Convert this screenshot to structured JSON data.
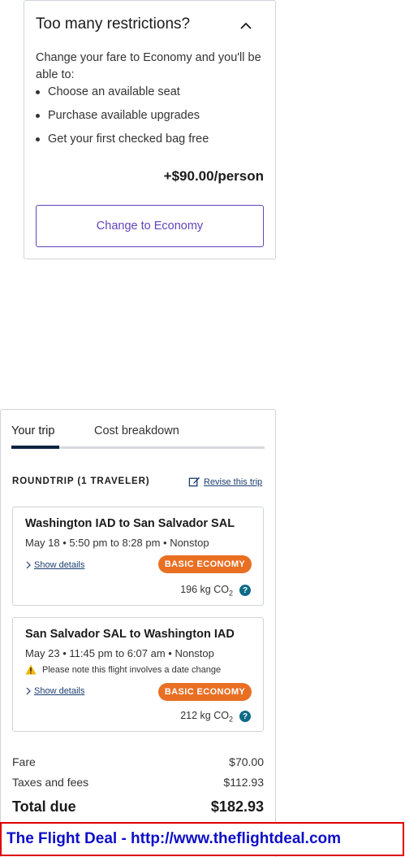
{
  "restrictions": {
    "title": "Too many restrictions?",
    "intro": "Change your fare to Economy and you'll be able to:",
    "benefits": [
      "Choose an available seat",
      "Purchase available upgrades",
      "Get your first checked bag free"
    ],
    "price": "+$90.00/person",
    "button_label": "Change to Economy",
    "toggle_icon": "chevron-up-icon"
  },
  "trip": {
    "tabs": [
      "Your trip",
      "Cost breakdown"
    ],
    "active_tab": "Your trip",
    "summary_label": "ROUNDTRIP (1 TRAVELER)",
    "revise_label": "Revise this trip",
    "flights": [
      {
        "route": "Washington IAD to San Salvador SAL",
        "time": "May 18 • 5:50 pm to 8:28 pm • Nonstop",
        "details_label": "Show details",
        "fare_class": "BASIC ECONOMY",
        "co2": "196 kg CO",
        "co2_sub": "2"
      },
      {
        "route": "San Salvador SAL to Washington IAD",
        "time": "May 23 • 11:45 pm to 6:07 am • Nonstop",
        "warning": "Please note this flight involves a date change",
        "details_label": "Show details",
        "fare_class": "BASIC ECONOMY",
        "co2": "212 kg CO",
        "co2_sub": "2"
      }
    ],
    "costs": {
      "fare_label": "Fare",
      "fare_value": "$70.00",
      "taxes_label": "Taxes and fees",
      "taxes_value": "$112.93",
      "total_label": "Total due",
      "total_value": "$182.93"
    }
  },
  "banner": {
    "text": "The Flight Deal - http://www.theflightdeal.com"
  },
  "colors": {
    "accent_purple": "#6244bb",
    "badge_orange": "#e96f23",
    "navy": "#0c2340",
    "info_teal": "#0c6b86",
    "banner_border": "#e00000",
    "banner_text": "#0d0dc8"
  }
}
